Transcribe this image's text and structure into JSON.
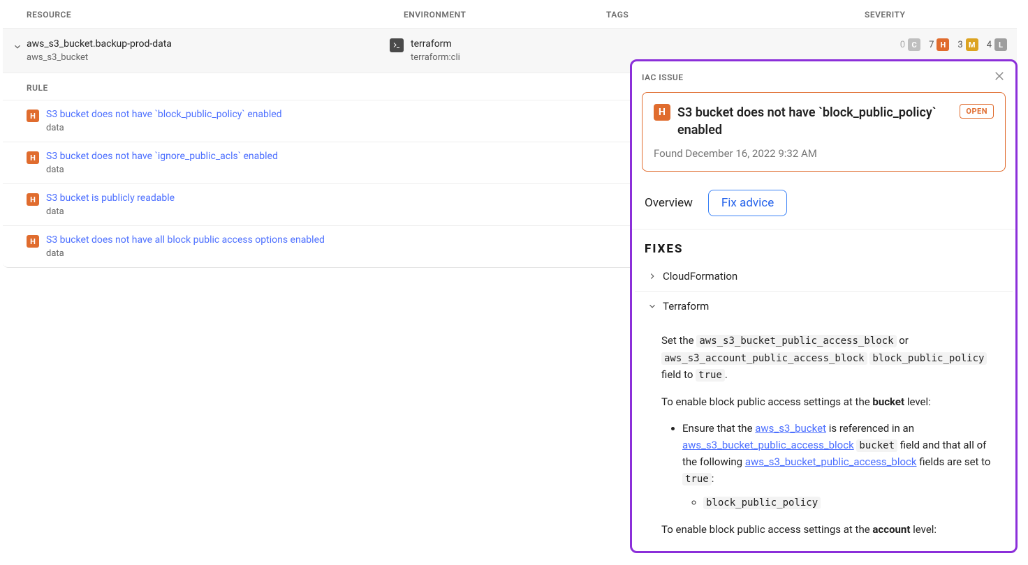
{
  "headers": {
    "resource": "RESOURCE",
    "environment": "ENVIRONMENT",
    "tags": "TAGS",
    "severity": "SEVERITY"
  },
  "resource": {
    "name": "aws_s3_bucket.backup-prod-data",
    "type": "aws_s3_bucket",
    "env_line1": "terraform",
    "env_line2": "terraform:cli"
  },
  "severity": {
    "critical": {
      "count": "0",
      "letter": "C"
    },
    "high": {
      "count": "7",
      "letter": "H"
    },
    "medium": {
      "count": "3",
      "letter": "M"
    },
    "low": {
      "count": "4",
      "letter": "L"
    }
  },
  "rule_header": "RULE",
  "rules": [
    {
      "sev": "H",
      "title": "S3 bucket does not have `block_public_policy` enabled",
      "sub": "data"
    },
    {
      "sev": "H",
      "title": "S3 bucket does not have `ignore_public_acls` enabled",
      "sub": "data"
    },
    {
      "sev": "H",
      "title": "S3 bucket is publicly readable",
      "sub": "data"
    },
    {
      "sev": "H",
      "title": "S3 bucket does not have all block public access options enabled",
      "sub": "data"
    }
  ],
  "panel": {
    "label": "IAC ISSUE",
    "issue_title": "S3 bucket does not have `block_public_policy` enabled",
    "issue_badge": "H",
    "status": "OPEN",
    "found": "Found December 16, 2022 9:32 AM",
    "tab_overview": "Overview",
    "tab_fix": "Fix advice",
    "fixes_title": "FIXES",
    "collapsed_item": "CloudFormation",
    "expanded_item": "Terraform",
    "fix_p1_a": "Set the ",
    "fix_p1_code1": "aws_s3_bucket_public_access_block",
    "fix_p1_b": " or ",
    "fix_p1_code2": "aws_s3_account_public_access_block",
    "fix_p1_c": " ",
    "fix_p1_code3": "block_public_policy",
    "fix_p1_d": " field to ",
    "fix_p1_code4": "true",
    "fix_p1_e": ".",
    "fix_p2_a": "To enable block public access settings at the ",
    "fix_p2_b": "bucket",
    "fix_p2_c": " level:",
    "bullet1_a": "Ensure that the ",
    "bullet1_link1": "aws_s3_bucket",
    "bullet1_b": " is referenced in an ",
    "bullet1_link2": "aws_s3_bucket_public_access_block",
    "bullet1_c": " ",
    "bullet1_code1": "bucket",
    "bullet1_d": " field and that all of the following ",
    "bullet1_link3": "aws_s3_bucket_public_access_block",
    "bullet1_e": " fields are set to ",
    "bullet1_code2": "true",
    "bullet1_f": ":",
    "subbullet": "block_public_policy",
    "fix_p3_a": "To enable block public access settings at the ",
    "fix_p3_b": "account",
    "fix_p3_c": " level:"
  }
}
